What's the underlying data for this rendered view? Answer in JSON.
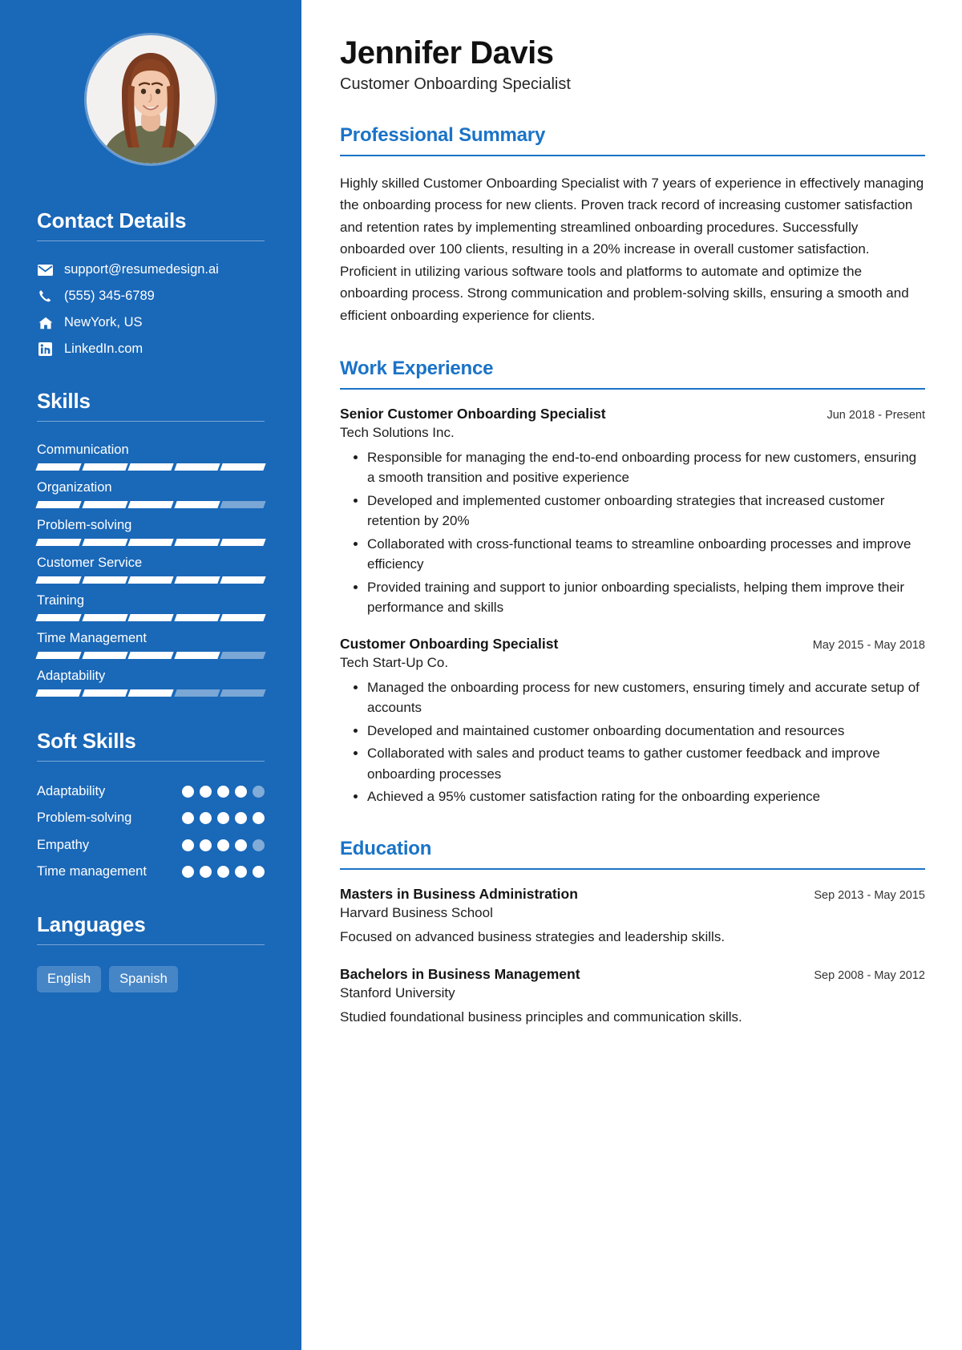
{
  "theme": {
    "sidebar_bg": "#1a68b8",
    "accent": "#1a73c7",
    "text": "#1d1d1d"
  },
  "header": {
    "name": "Jennifer Davis",
    "role": "Customer Onboarding Specialist"
  },
  "sidebar": {
    "avatar_alt": "profile-photo",
    "contact": {
      "heading": "Contact Details",
      "items": [
        {
          "icon": "envelope-icon",
          "value": "support@resumedesign.ai"
        },
        {
          "icon": "phone-icon",
          "value": "(555) 345-6789"
        },
        {
          "icon": "home-icon",
          "value": "NewYork, US"
        },
        {
          "icon": "linkedin-icon",
          "value": "LinkedIn.com"
        }
      ]
    },
    "skills": {
      "heading": "Skills",
      "segments_total": 5,
      "items": [
        {
          "label": "Communication",
          "filled": 5
        },
        {
          "label": "Organization",
          "filled": 4
        },
        {
          "label": "Problem-solving",
          "filled": 5
        },
        {
          "label": "Customer Service",
          "filled": 5
        },
        {
          "label": "Training",
          "filled": 5
        },
        {
          "label": "Time Management",
          "filled": 4
        },
        {
          "label": "Adaptability",
          "filled": 3
        }
      ]
    },
    "soft_skills": {
      "heading": "Soft Skills",
      "dots_total": 5,
      "items": [
        {
          "label": "Adaptability",
          "filled": 4
        },
        {
          "label": "Problem-solving",
          "filled": 5
        },
        {
          "label": "Empathy",
          "filled": 4
        },
        {
          "label": "Time management",
          "filled": 5
        }
      ]
    },
    "languages": {
      "heading": "Languages",
      "items": [
        "English",
        "Spanish"
      ]
    }
  },
  "main": {
    "summary": {
      "heading": "Professional Summary",
      "text": "Highly skilled Customer Onboarding Specialist with 7 years of experience in effectively managing the onboarding process for new clients. Proven track record of increasing customer satisfaction and retention rates by implementing streamlined onboarding procedures. Successfully onboarded over 100 clients, resulting in a 20% increase in overall customer satisfaction. Proficient in utilizing various software tools and platforms to automate and optimize the onboarding process. Strong communication and problem-solving skills, ensuring a smooth and efficient onboarding experience for clients."
    },
    "work": {
      "heading": "Work Experience",
      "entries": [
        {
          "title": "Senior Customer Onboarding Specialist",
          "date": "Jun 2018 - Present",
          "org": "Tech Solutions Inc.",
          "bullets": [
            "Responsible for managing the end-to-end onboarding process for new customers, ensuring a smooth transition and positive experience",
            "Developed and implemented customer onboarding strategies that increased customer retention by 20%",
            "Collaborated with cross-functional teams to streamline onboarding processes and improve efficiency",
            "Provided training and support to junior onboarding specialists, helping them improve their performance and skills"
          ]
        },
        {
          "title": "Customer Onboarding Specialist",
          "date": "May 2015 - May 2018",
          "org": "Tech Start-Up Co.",
          "bullets": [
            "Managed the onboarding process for new customers, ensuring timely and accurate setup of accounts",
            "Developed and maintained customer onboarding documentation and resources",
            "Collaborated with sales and product teams to gather customer feedback and improve onboarding processes",
            "Achieved a 95% customer satisfaction rating for the onboarding experience"
          ]
        }
      ]
    },
    "education": {
      "heading": "Education",
      "entries": [
        {
          "title": "Masters in Business Administration",
          "date": "Sep 2013 - May 2015",
          "org": "Harvard Business School",
          "desc": "Focused on advanced business strategies and leadership skills."
        },
        {
          "title": "Bachelors in Business Management",
          "date": "Sep 2008 - May 2012",
          "org": "Stanford University",
          "desc": "Studied foundational business principles and communication skills."
        }
      ]
    }
  }
}
